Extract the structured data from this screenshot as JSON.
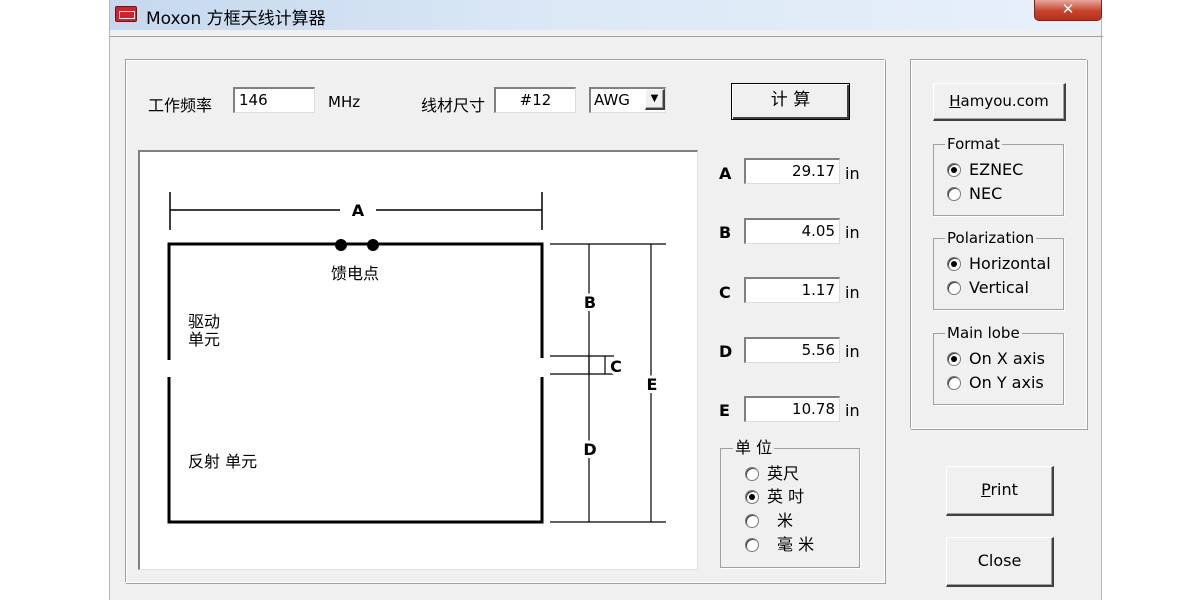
{
  "window": {
    "title": "Moxon 方框天线计算器",
    "close_glyph": "✕"
  },
  "params": {
    "freq_label": "工作频率",
    "freq_value": "146",
    "freq_unit": "MHz",
    "wire_label": "线材尺寸",
    "wire_value": "#12",
    "wire_type": "AWG",
    "calc_button": "计  算"
  },
  "diagram": {
    "label_A": "A",
    "label_B": "B",
    "label_C": "C",
    "label_D": "D",
    "label_E": "E",
    "feed_point": "馈电点",
    "driven_line1": "驱动",
    "driven_line2": "单元",
    "reflector": "反射 单元"
  },
  "results": [
    {
      "label": "A",
      "value": "29.17",
      "unit": "in"
    },
    {
      "label": "B",
      "value": "4.05",
      "unit": "in"
    },
    {
      "label": "C",
      "value": "1.17",
      "unit": "in"
    },
    {
      "label": "D",
      "value": "5.56",
      "unit": "in"
    },
    {
      "label": "E",
      "value": "10.78",
      "unit": "in"
    }
  ],
  "units_group": {
    "title": "单    位",
    "options": [
      "英尺",
      "英 吋",
      "米",
      "毫  米"
    ],
    "selected": "英 吋"
  },
  "sidebar": {
    "link_button": "Hamyou.com",
    "format": {
      "title": "Format",
      "options": [
        "EZNEC",
        "NEC"
      ],
      "selected": "EZNEC"
    },
    "polarization": {
      "title": "Polarization",
      "options": [
        "Horizontal",
        "Vertical"
      ],
      "selected": "Horizontal"
    },
    "main_lobe": {
      "title": "Main lobe",
      "options": [
        "On X axis",
        "On Y axis"
      ],
      "selected": "On X axis"
    },
    "print_button": "Print",
    "close_button": "Close"
  }
}
